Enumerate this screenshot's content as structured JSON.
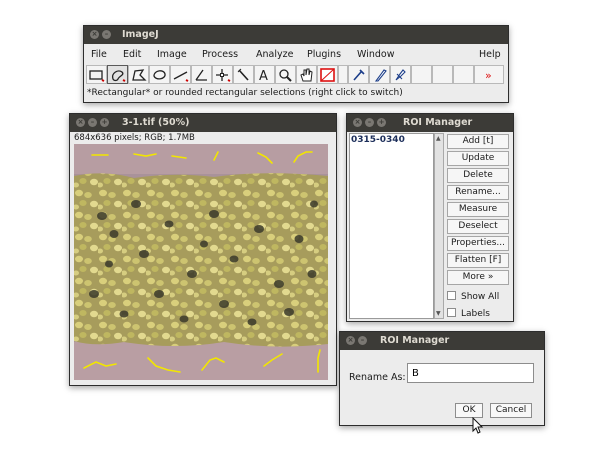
{
  "imagej": {
    "title": "ImageJ",
    "menus": [
      "File",
      "Edit",
      "Image",
      "Process",
      "Analyze",
      "Plugins",
      "Window",
      "Help"
    ],
    "tools": [
      "rectangle-selection-icon",
      "freehand-selection-icon",
      "polygon-selection-icon",
      "oval-selection-icon",
      "line-selection-icon",
      "angle-tool-icon",
      "point-tool-icon",
      "wand-tool-icon",
      "text-tool-icon",
      "magnifier-icon",
      "hand-scroll-icon",
      "color-picker-icon",
      "dropper-icon",
      "pencil-icon",
      "brush-icon",
      "more-tools-icon"
    ],
    "status": "*Rectangular* or rounded rectangular selections (right click to switch)"
  },
  "image_window": {
    "title": "3-1.tif (50%)",
    "info": "684x636 pixels; RGB; 1.7MB"
  },
  "roi_manager": {
    "title": "ROI Manager",
    "list_items": [
      "0315-0340"
    ],
    "buttons": [
      "Add [t]",
      "Update",
      "Delete",
      "Rename...",
      "Measure",
      "Deselect",
      "Properties...",
      "Flatten [F]",
      "More »"
    ],
    "show_all": "Show All",
    "labels": "Labels"
  },
  "rename_dialog": {
    "title": "ROI Manager",
    "label": "Rename As:",
    "value": "B",
    "ok": "OK",
    "cancel": "Cancel"
  },
  "colors": {
    "titlebar": "#3c3b37",
    "window_bg": "#ececec",
    "roi_outline": "#f2e600"
  }
}
